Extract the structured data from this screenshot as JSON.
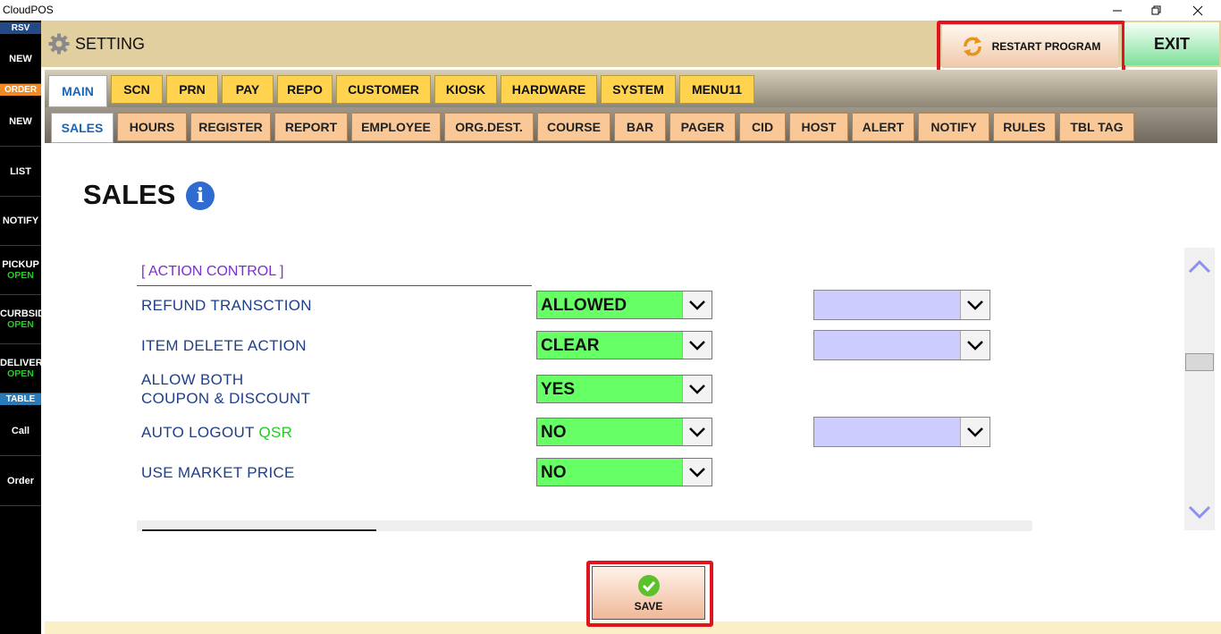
{
  "window": {
    "title": "CloudPOS"
  },
  "sidebar": {
    "rsv_header": "RSV",
    "order_header": "ORDER",
    "table_header": "TABLE",
    "items": [
      {
        "label": "NEW"
      },
      {
        "label": "NEW"
      },
      {
        "label": "LIST"
      },
      {
        "label": "NOTIFY"
      },
      {
        "label": "PICKUP",
        "sub": "OPEN"
      },
      {
        "label": "CURBSID",
        "sub": "OPEN"
      },
      {
        "label": "DELIVERY",
        "sub": "OPEN"
      },
      {
        "label": "Call"
      },
      {
        "label": "Order"
      }
    ]
  },
  "header": {
    "title": "SETTING",
    "restart_label": "RESTART PROGRAM",
    "exit_label": "EXIT"
  },
  "tabs_primary": [
    "MAIN",
    "SCN",
    "PRN",
    "PAY",
    "REPO",
    "CUSTOMER",
    "KIOSK",
    "HARDWARE",
    "SYSTEM",
    "MENU11"
  ],
  "tabs_secondary": [
    "SALES",
    "HOURS",
    "REGISTER",
    "REPORT",
    "EMPLOYEE",
    "ORG.DEST.",
    "COURSE",
    "BAR",
    "PAGER",
    "CID",
    "HOST",
    "ALERT",
    "NOTIFY",
    "RULES",
    "TBL TAG"
  ],
  "active_primary": "MAIN",
  "active_secondary": "SALES",
  "page": {
    "title": "SALES",
    "section_label": "[ ACTION CONTROL ]",
    "rows": [
      {
        "label": "REFUND TRANSCTION",
        "value": "ALLOWED"
      },
      {
        "label": "ITEM DELETE ACTION",
        "value": "CLEAR"
      },
      {
        "label_line1": "ALLOW BOTH",
        "label_line2": "COUPON & DISCOUNT",
        "value": "YES"
      },
      {
        "label": "AUTO LOGOUT",
        "label_suffix": "QSR",
        "value": "NO"
      },
      {
        "label": "USE MARKET PRICE",
        "value": "NO"
      }
    ]
  },
  "save_label": "SAVE",
  "colors": {
    "header_bg": "#e2cf9f",
    "primary_tab": "#ffd34d",
    "secondary_tab": "#f9c896",
    "dropdown_green": "#66ff66",
    "dropdown_lavender": "#ccccff",
    "highlight_red": "#e0141e",
    "section_purple": "#7a2fcf",
    "label_blue": "#1f3f8a"
  }
}
